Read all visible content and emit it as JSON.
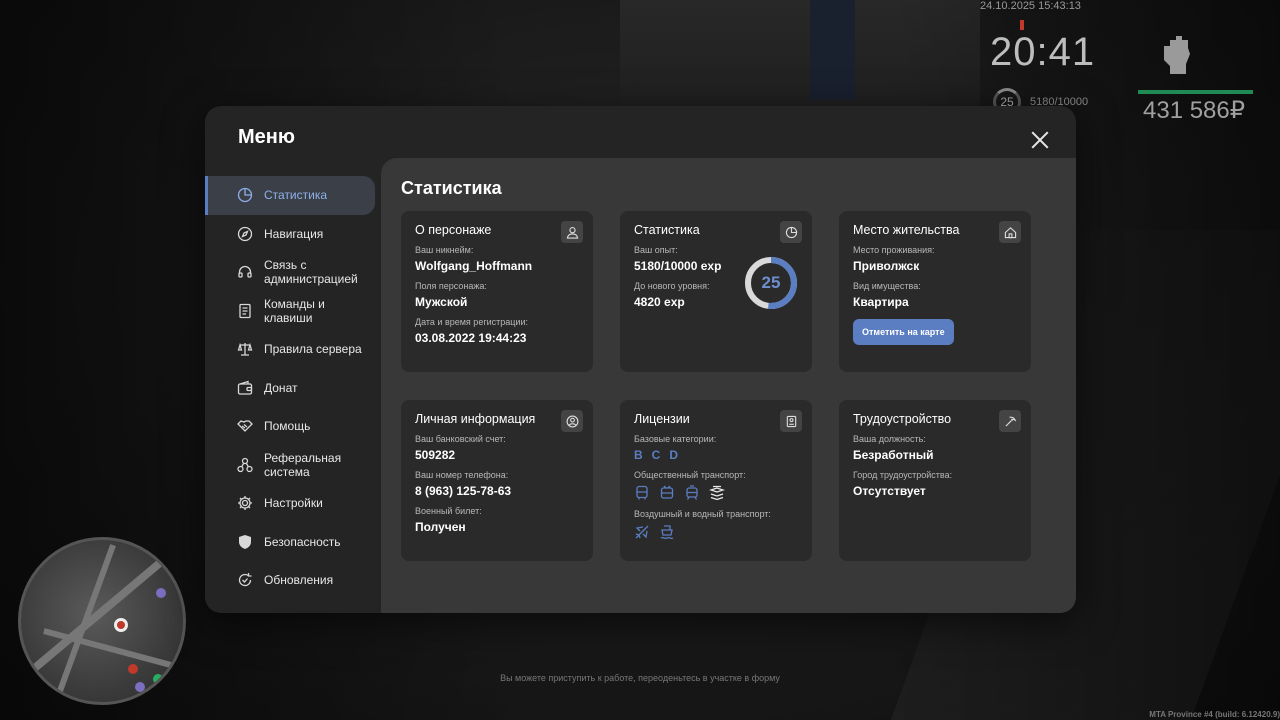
{
  "hud": {
    "datetime": "24.10.2025 15:43:13",
    "clock": "20:41",
    "level": "25",
    "exp": "5180/10000",
    "money": "431 586₽"
  },
  "hint": "Вы можете приступить к работе, переоденьтесь в участке в форму",
  "build": "MTA Province #4 (build: 6.12420.9)",
  "menu": {
    "title": "Меню",
    "sidebar": [
      {
        "label": "Статистика",
        "icon": "pie-chart-icon",
        "active": true
      },
      {
        "label": "Навигация",
        "icon": "compass-icon"
      },
      {
        "label": "Связь с администрацией",
        "icon": "headset-icon"
      },
      {
        "label": "Команды и клавиши",
        "icon": "document-icon"
      },
      {
        "label": "Правила сервера",
        "icon": "scales-icon"
      },
      {
        "label": "Донат",
        "icon": "wallet-icon"
      },
      {
        "label": "Помощь",
        "icon": "handshake-icon"
      },
      {
        "label": "Реферальная система",
        "icon": "network-icon"
      },
      {
        "label": "Настройки",
        "icon": "gear-icon"
      },
      {
        "label": "Безопасность",
        "icon": "shield-icon"
      },
      {
        "label": "Обновления",
        "icon": "refresh-icon"
      }
    ],
    "content_title": "Статистика",
    "cards": {
      "character": {
        "title": "О персонаже",
        "nickname_label": "Ваш никнейм:",
        "nickname": "Wolfgang_Hoffmann",
        "gender_label": "Поля персонажа:",
        "gender": "Мужской",
        "reg_label": "Дата и время регистрации:",
        "reg": "03.08.2022 19:44:23"
      },
      "stats": {
        "title": "Статистика",
        "exp_label": "Ваш опыт:",
        "exp": "5180/10000 exp",
        "next_label": "До нового уровня:",
        "next": "4820 exp",
        "level": "25",
        "progress": 0.518
      },
      "residence": {
        "title": "Место жительства",
        "place_label": "Место проживания:",
        "place": "Приволжск",
        "property_label": "Вид имущества:",
        "property": "Квартира",
        "button": "Отметить на карте"
      },
      "personal": {
        "title": "Личная информация",
        "bank_label": "Ваш банковский счет:",
        "bank": "509282",
        "phone_label": "Ваш номер телефона:",
        "phone": "8 (963) 125-78-63",
        "military_label": "Военный билет:",
        "military": "Получен"
      },
      "licenses": {
        "title": "Лицензии",
        "base_label": "Базовые категории:",
        "base": [
          "B",
          "C",
          "D"
        ],
        "public_label": "Общественный транспорт:",
        "public_icons": [
          "bus-icon",
          "trolleybus-icon",
          "tram-icon",
          "taxi-icon"
        ],
        "air_label": "Воздушный и водный транспорт:",
        "air_icons": [
          "plane-icon",
          "boat-icon"
        ]
      },
      "job": {
        "title": "Трудоустройство",
        "position_label": "Ваша должность:",
        "position": "Безработный",
        "city_label": "Город трудоустройства:",
        "city": "Отсутствует"
      }
    }
  }
}
